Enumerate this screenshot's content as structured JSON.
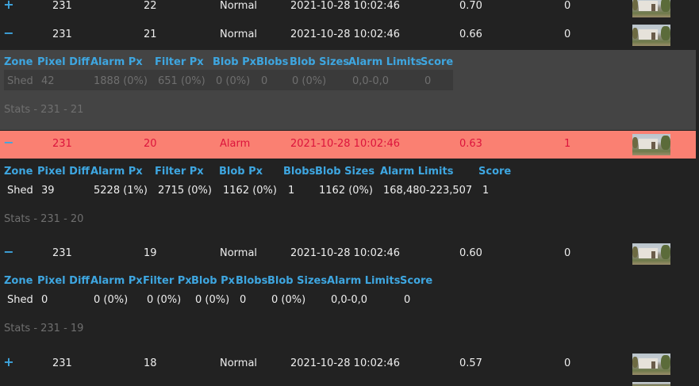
{
  "toggle_expand": "+",
  "toggle_collapse": "−",
  "rows": [
    {
      "event": "231",
      "frame": "22",
      "type": "Normal",
      "time": "2021-10-28 10:02:46",
      "score": "0.70",
      "alarm": "0"
    },
    {
      "event": "231",
      "frame": "21",
      "type": "Normal",
      "time": "2021-10-28 10:02:46",
      "score": "0.66",
      "alarm": "0"
    },
    {
      "event": "231",
      "frame": "20",
      "type": "Alarm",
      "time": "2021-10-28 10:02:46",
      "score": "0.63",
      "alarm": "1"
    },
    {
      "event": "231",
      "frame": "19",
      "type": "Normal",
      "time": "2021-10-28 10:02:46",
      "score": "0.60",
      "alarm": "0"
    },
    {
      "event": "231",
      "frame": "18",
      "type": "Normal",
      "time": "2021-10-28 10:02:46",
      "score": "0.57",
      "alarm": "0"
    }
  ],
  "zone_headers": [
    "Zone",
    "Pixel Diff",
    "Alarm Px",
    "Filter Px",
    "Blob Px",
    "Blobs",
    "Blob Sizes",
    "Alarm Limits",
    "Score"
  ],
  "details": [
    {
      "zone": "Shed",
      "pixel_diff": "42",
      "alarm_px": "1888 (0%)",
      "filter_px": "651 (0%)",
      "blob_px": "0 (0%)",
      "blobs": "0",
      "blob_sizes": "0 (0%)",
      "alarm_limits": "0,0-0,0",
      "score": "0",
      "stats": "Stats - 231 - 21"
    },
    {
      "zone": "Shed",
      "pixel_diff": "39",
      "alarm_px": "5228 (1%)",
      "filter_px": "2715 (0%)",
      "blob_px": "1162 (0%)",
      "blobs": "1",
      "blob_sizes": "1162 (0%)",
      "alarm_limits": "168,480-223,507",
      "score": "1",
      "stats": "Stats - 231 - 20"
    },
    {
      "zone": "Shed",
      "pixel_diff": "0",
      "alarm_px": "0 (0%)",
      "filter_px": "0 (0%)",
      "blob_px": "0 (0%)",
      "blobs": "0",
      "blob_sizes": "0 (0%)",
      "alarm_limits": "0,0-0,0",
      "score": "0",
      "stats": "Stats - 231 - 19"
    }
  ]
}
